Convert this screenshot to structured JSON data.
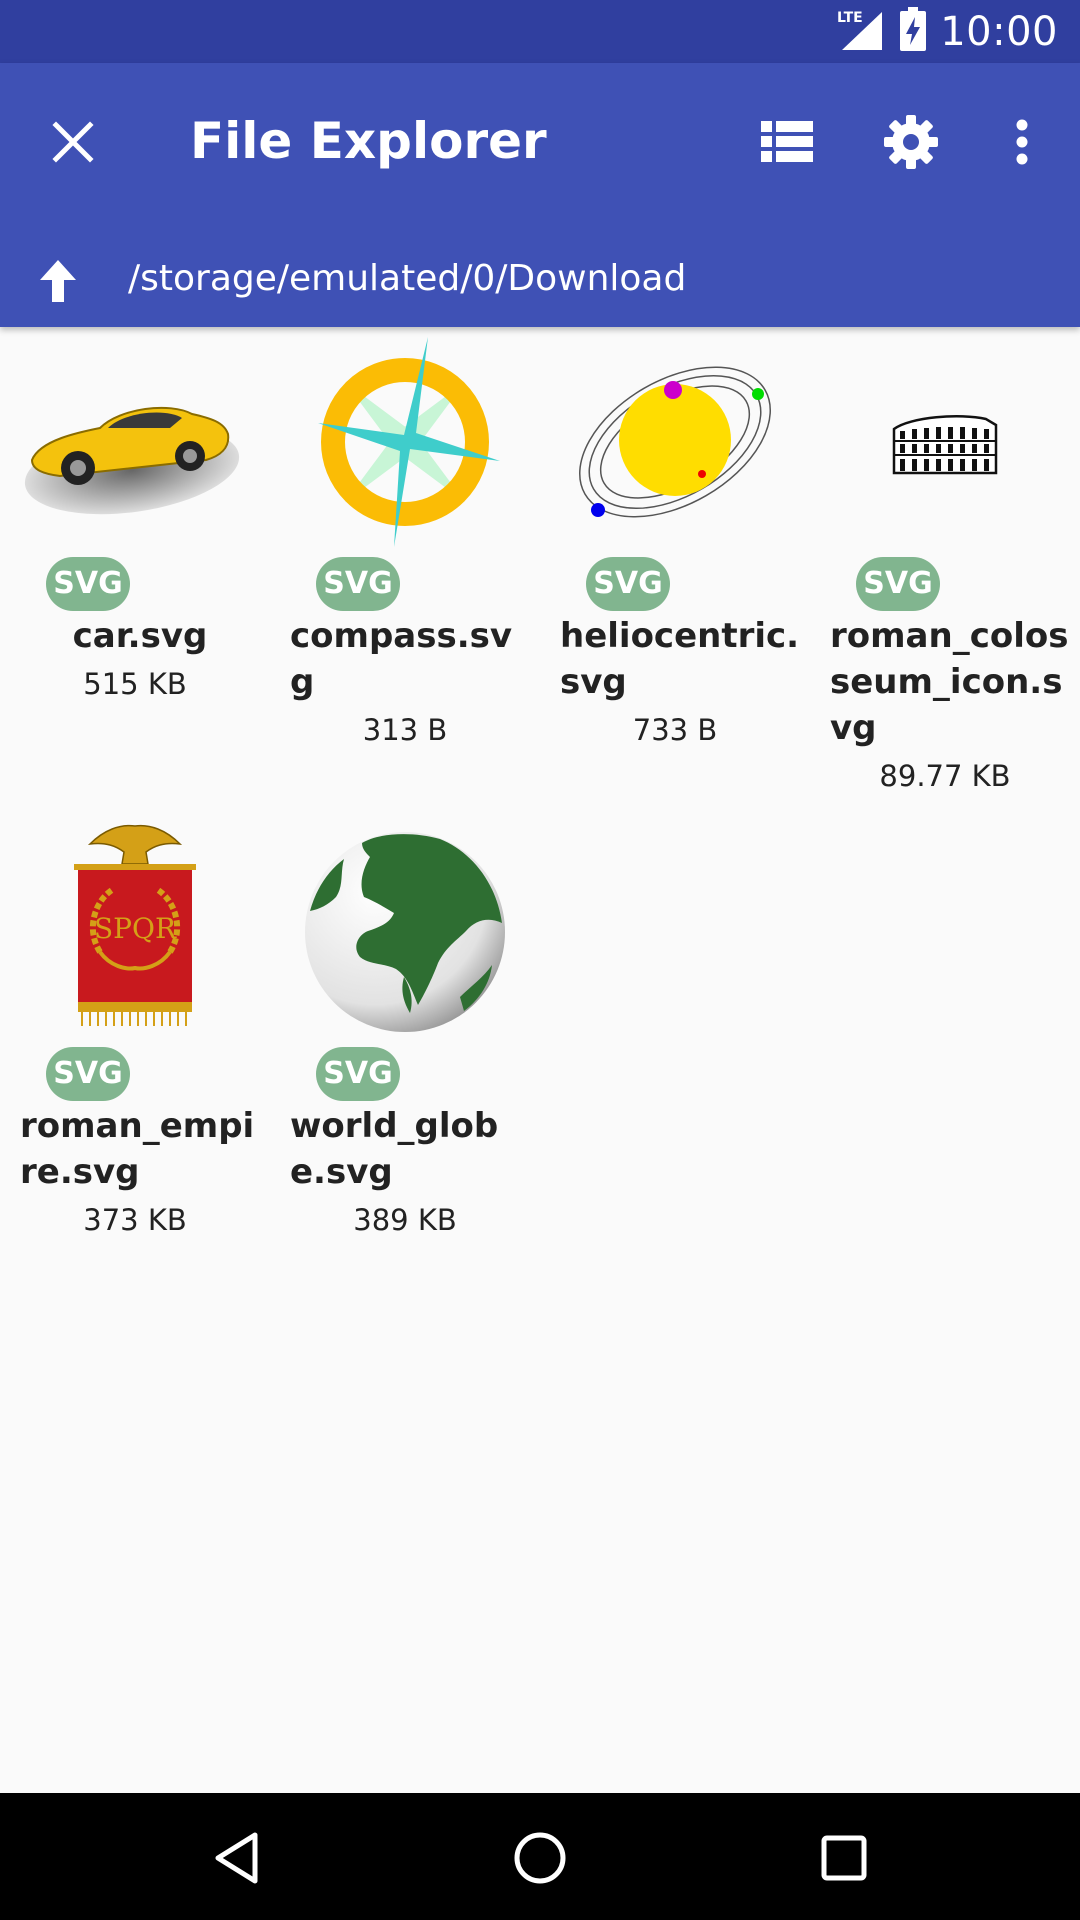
{
  "status_bar": {
    "network": "LTE",
    "time": "10:00"
  },
  "app_bar": {
    "title": "File Explorer",
    "path": "/storage/emulated/0/Download"
  },
  "files": [
    {
      "name": "car.svg",
      "size": "515 KB",
      "type": "SVG"
    },
    {
      "name": "compass.svg",
      "size": "313 B",
      "type": "SVG"
    },
    {
      "name": "heliocentric.svg",
      "size": "733 B",
      "type": "SVG"
    },
    {
      "name": "roman_colosseum_icon.svg",
      "size": "89.77 KB",
      "type": "SVG"
    },
    {
      "name": "roman_empire.svg",
      "size": "373 KB",
      "type": "SVG"
    },
    {
      "name": "world_globe.svg",
      "size": "389 KB",
      "type": "SVG"
    }
  ],
  "thumb_text": {
    "spqr": "SPQR"
  },
  "colors": {
    "status_bar": "#303F9F",
    "app_bar": "#3F51B5",
    "badge": "#81B58F",
    "background": "#FAFAFA"
  }
}
